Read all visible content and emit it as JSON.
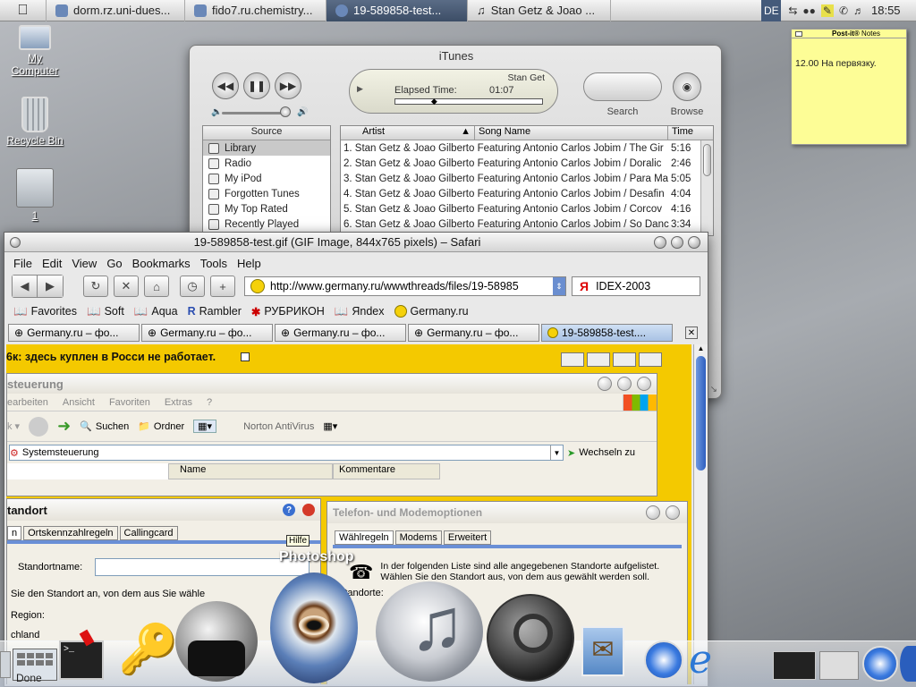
{
  "menubar": {
    "tabs": [
      {
        "label": "dorm.rz.uni-dues...",
        "active": false
      },
      {
        "label": "fido7.ru.chemistry...",
        "active": false
      },
      {
        "label": "19-589858-test...",
        "active": true
      },
      {
        "label": "Stan Getz & Joao ...",
        "active": false
      }
    ],
    "input_indicator": "DE",
    "clock": "18:55"
  },
  "desktop": {
    "icons": [
      {
        "label": "My\nComputer"
      },
      {
        "label": "Recycle Bin"
      },
      {
        "label": "1"
      }
    ]
  },
  "itunes": {
    "title": "iTunes",
    "lcd_track": "Stan Get",
    "lcd_elapsed_label": "Elapsed Time:",
    "lcd_elapsed_value": "01:07",
    "progress": 0.27,
    "search_label": "Search",
    "browse_label": "Browse",
    "source_header": "Source",
    "sources": [
      "Library",
      "Radio",
      "My iPod",
      "Forgotten Tunes",
      "My Top Rated",
      "Recently Played"
    ],
    "columns": [
      "Artist",
      "Song Name",
      "Time"
    ],
    "tracks": [
      {
        "text": "1. Stan Getz & Joao Gilberto Featuring Antonio Carlos Jobim / The Gir",
        "time": "5:16"
      },
      {
        "text": "2. Stan Getz & Joao Gilberto Featuring Antonio Carlos Jobim / Doralic",
        "time": "2:46"
      },
      {
        "text": "3. Stan Getz & Joao Gilberto Featuring Antonio Carlos Jobim / Para Ma",
        "time": "5:05"
      },
      {
        "text": "4. Stan Getz & Joao Gilberto Featuring Antonio Carlos Jobim / Desafin",
        "time": "4:04"
      },
      {
        "text": "5. Stan Getz & Joao Gilberto Featuring Antonio Carlos Jobim / Corcov",
        "time": "4:16"
      },
      {
        "text": "6. Stan Getz & Joao Gilberto Featuring Antonio Carlos Jobim / So Danc",
        "time": "3:34"
      }
    ]
  },
  "postit": {
    "title": "Post-it",
    "title_suffix": "Notes",
    "note": "12.00 На первязку."
  },
  "safari": {
    "title": "19-589858-test.gif (GIF Image, 844x765 pixels) – Safari",
    "menu": [
      "File",
      "Edit",
      "View",
      "Go",
      "Bookmarks",
      "Tools",
      "Help"
    ],
    "url": "http://www.germany.ru/wwwthreads/files/19-58985",
    "search_value": "IDEX-2003",
    "bookmarks": [
      "Favorites",
      "Soft",
      "Aqua",
      "Rambler",
      "РУБРИКОН",
      "Яndex",
      "Germany.ru"
    ],
    "tabs": [
      {
        "label": "Germany.ru – фо..."
      },
      {
        "label": "Germany.ru – фо..."
      },
      {
        "label": "Germany.ru – фо..."
      },
      {
        "label": "Germany.ru – фо..."
      },
      {
        "label": "19-589858-test...."
      }
    ],
    "page_header_text": "6к: здесь куплен в Росси не работает."
  },
  "xp_window": {
    "title": "steuerung",
    "menu": [
      "earbeiten",
      "Ansicht",
      "Favoriten",
      "Extras",
      "?"
    ],
    "toolbar_search": "Suchen",
    "toolbar_folder": "Ordner",
    "toolbar_norton": "Norton AntiVirus",
    "address": "Systemsteuerung",
    "go_label": "Wechseln zu",
    "col_name": "Name",
    "col_comment": "Kommentare"
  },
  "standort": {
    "title": "tandort",
    "tabs": [
      "n",
      "Ortskennzahlregeln",
      "Callingcard"
    ],
    "tooltip": "Hilfe",
    "name_label": "Standortname:",
    "instruction": "Sie den Standort an, von dem aus Sie wähle",
    "region_label": "Region:",
    "region_value": "chland"
  },
  "modem": {
    "title": "Telefon- und Modemoptionen",
    "tabs": [
      "Wählregeln",
      "Modems",
      "Erweitert"
    ],
    "text": "In der folgenden Liste sind alle angegebenen Standorte aufgelistet. Wählen Sie den Standort aus, von dem aus gewählt werden soll.",
    "sub_label": "Standorte:"
  },
  "dock": {
    "hover_label": "Photoshop",
    "bottom_text": "Done"
  }
}
